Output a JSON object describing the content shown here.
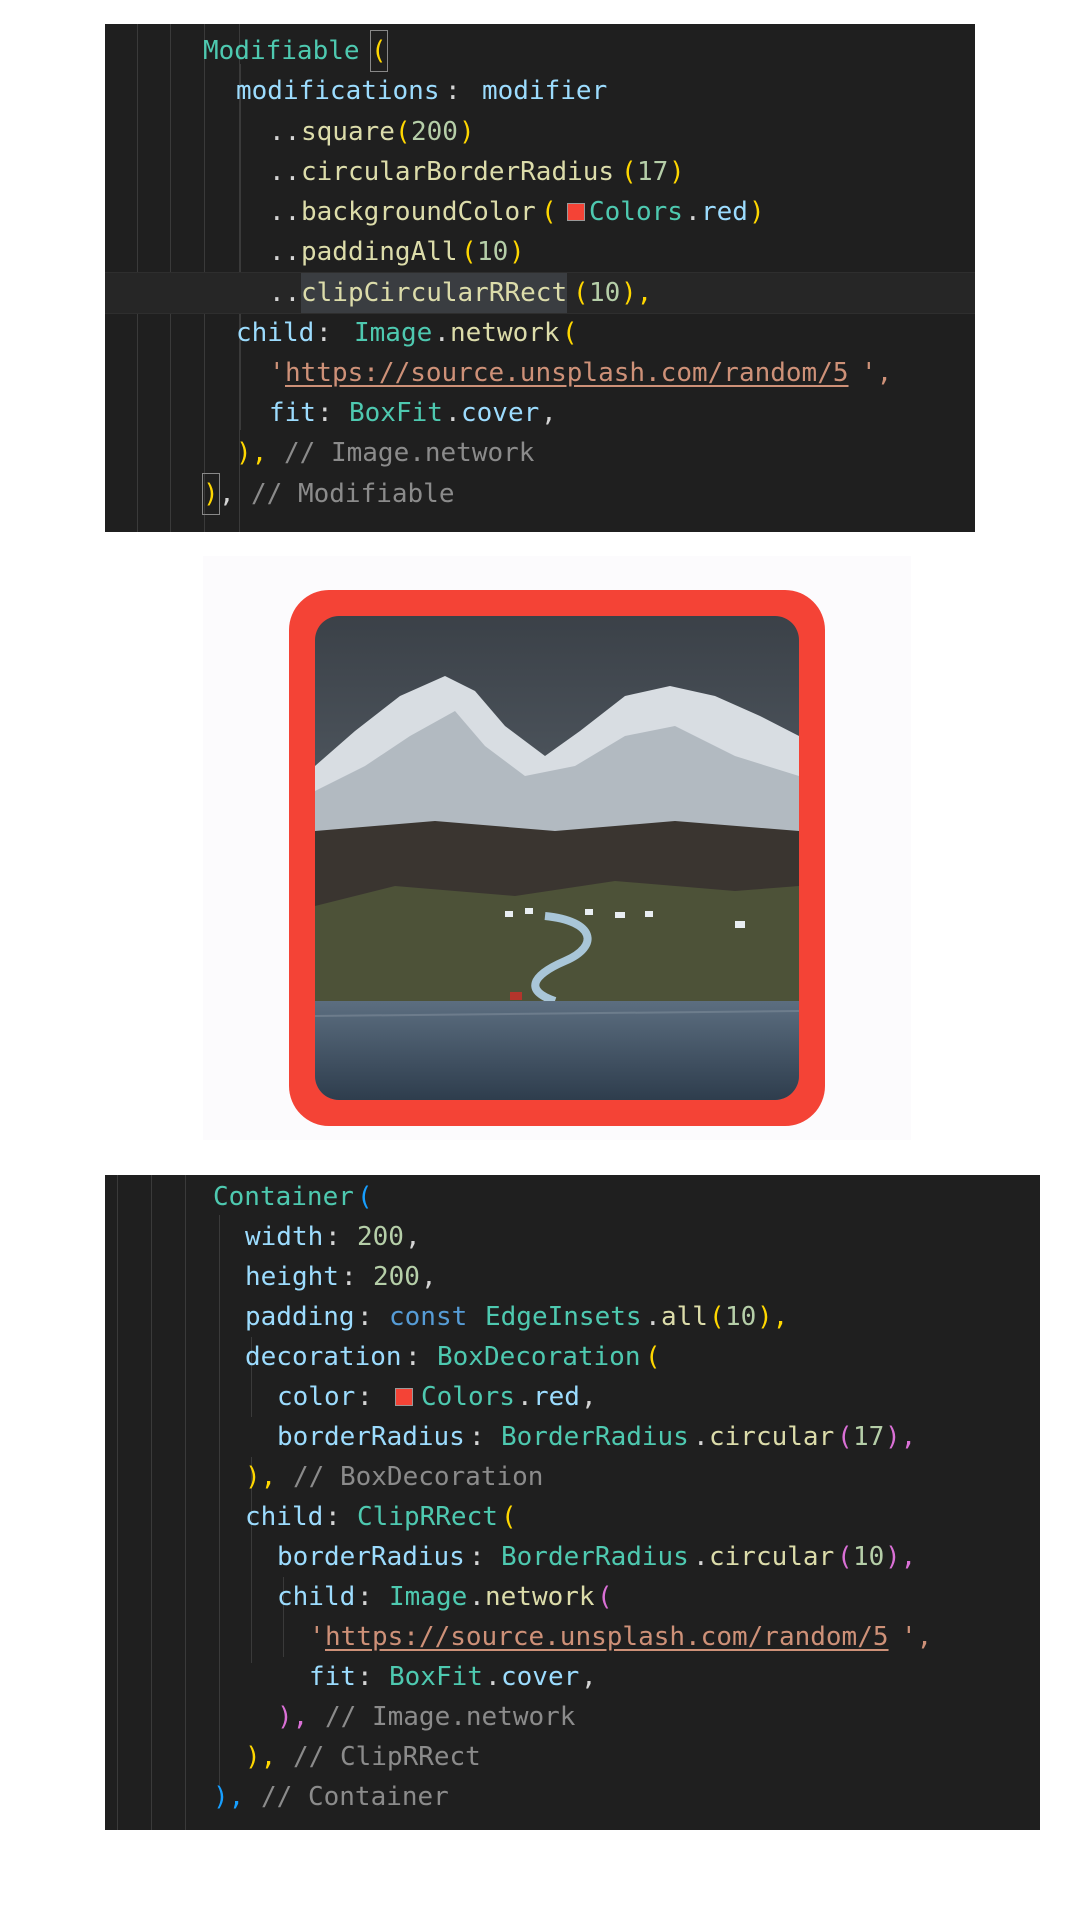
{
  "colors": {
    "editor_bg": "#1f1f1f",
    "swatch_red": "#f44336",
    "frame_red": "#f44336",
    "preview_bg": "#fcfbfd"
  },
  "top_code": {
    "lines": [
      [
        "Modifiable",
        "("
      ],
      [
        "modifications",
        ": ",
        "modifier"
      ],
      [
        "..",
        "square",
        "(",
        "200",
        ")"
      ],
      [
        "..",
        "circularBorderRadius",
        "(",
        "17",
        ")"
      ],
      [
        "..",
        "backgroundColor",
        "(",
        "Colors",
        ".",
        "red",
        ")"
      ],
      [
        "..",
        "paddingAll",
        "(",
        "10",
        ")"
      ],
      [
        "..",
        "clipCircularRRect",
        "(",
        "10",
        "),"
      ],
      [
        "child",
        ": ",
        "Image",
        ".",
        "network",
        "("
      ],
      [
        "'",
        "https://source.unsplash.com/random/5",
        "',"
      ],
      [
        "fit",
        ": ",
        "BoxFit",
        ".",
        "cover",
        ","
      ],
      [
        "), ",
        "// Image.network"
      ],
      [
        ")",
        ", ",
        "// Modifiable"
      ]
    ]
  },
  "preview": {
    "image_icon": "photo-mountain-landscape-icon"
  },
  "bottom_code": {
    "lines": [
      [
        "Container",
        "("
      ],
      [
        "width",
        ": ",
        "200",
        ","
      ],
      [
        "height",
        ": ",
        "200",
        ","
      ],
      [
        "padding",
        ": ",
        "const",
        " ",
        "EdgeInsets",
        ".",
        "all",
        "(",
        "10",
        "),"
      ],
      [
        "decoration",
        ": ",
        "BoxDecoration",
        "("
      ],
      [
        "color",
        ": ",
        "Colors",
        ".",
        "red",
        ","
      ],
      [
        "borderRadius",
        ": ",
        "BorderRadius",
        ".",
        "circular",
        "(",
        "17",
        "),"
      ],
      [
        "), ",
        "// BoxDecoration"
      ],
      [
        "child",
        ": ",
        "ClipRRect",
        "("
      ],
      [
        "borderRadius",
        ": ",
        "BorderRadius",
        ".",
        "circular",
        "(",
        "10",
        "),"
      ],
      [
        "child",
        ": ",
        "Image",
        ".",
        "network",
        "("
      ],
      [
        "'",
        "https://source.unsplash.com/random/5",
        "',"
      ],
      [
        "fit",
        ": ",
        "BoxFit",
        ".",
        "cover",
        ","
      ],
      [
        "), ",
        "// Image.network"
      ],
      [
        "), ",
        "// ClipRRect"
      ],
      [
        "), ",
        "// Container"
      ]
    ]
  }
}
